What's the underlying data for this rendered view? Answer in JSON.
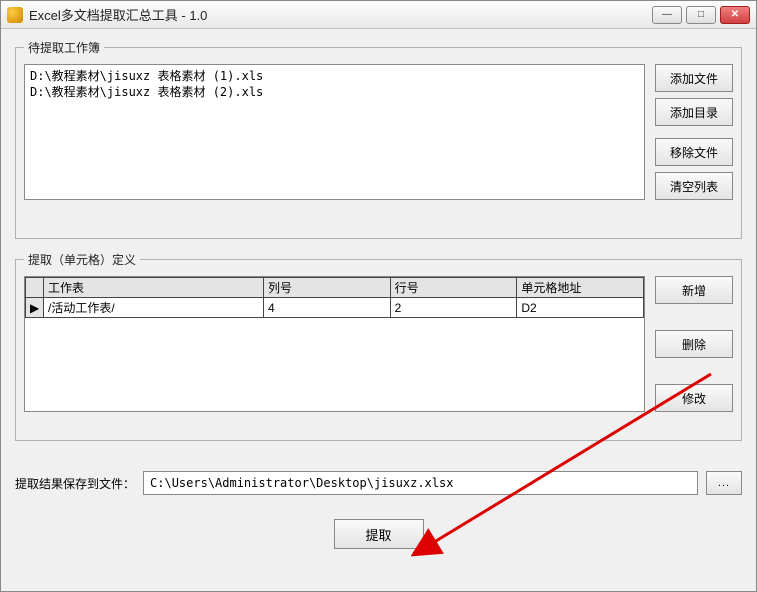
{
  "window": {
    "title": "Excel多文档提取汇总工具 - 1.0"
  },
  "group1": {
    "legend": "待提取工作簿",
    "files": [
      "D:\\教程素材\\jisuxz 表格素材 (1).xls",
      "D:\\教程素材\\jisuxz 表格素材 (2).xls"
    ],
    "buttons": {
      "add_file": "添加文件",
      "add_folder": "添加目录",
      "remove": "移除文件",
      "clear": "清空列表"
    }
  },
  "group2": {
    "legend": "提取（单元格）定义",
    "headers": {
      "sheet": "工作表",
      "col": "列号",
      "row": "行号",
      "addr": "单元格地址"
    },
    "rows": [
      {
        "marker": "▶",
        "sheet": "/活动工作表/",
        "col": "4",
        "row": "2",
        "addr": "D2"
      }
    ],
    "buttons": {
      "new": "新增",
      "delete": "删除",
      "edit": "修改"
    }
  },
  "save": {
    "label": "提取结果保存到文件：",
    "path": "C:\\Users\\Administrator\\Desktop\\jisuxz.xlsx",
    "browse": "..."
  },
  "extract": {
    "label": "提取"
  }
}
